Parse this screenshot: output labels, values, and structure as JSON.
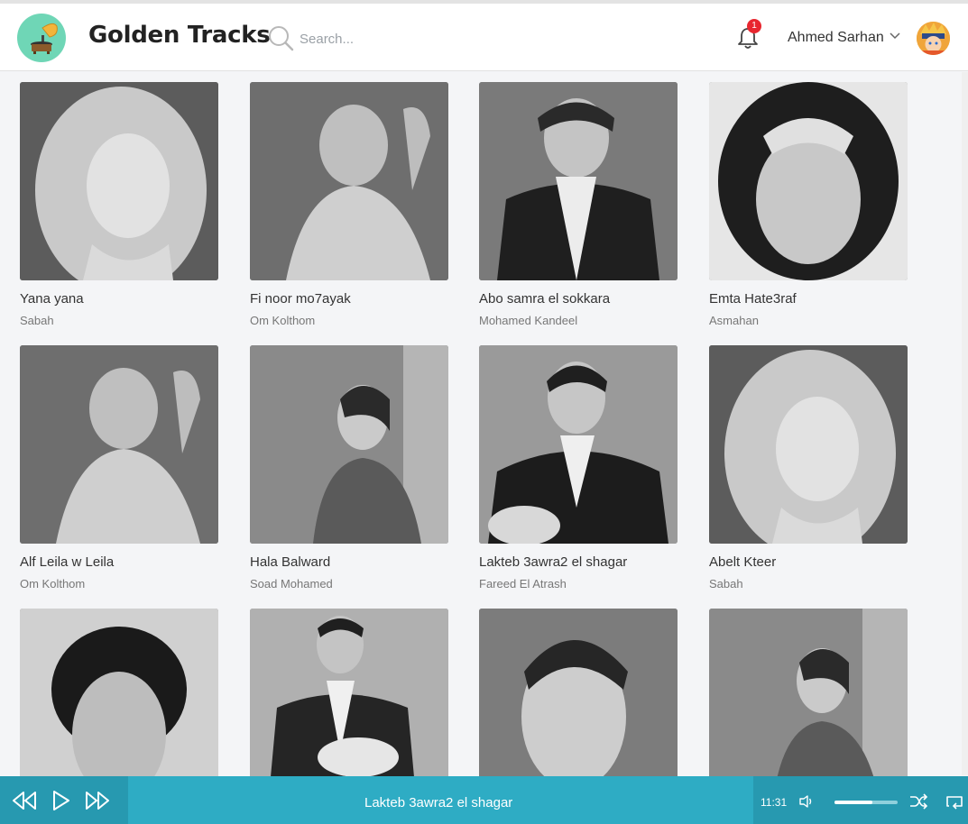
{
  "app": {
    "title": "Golden Tracks"
  },
  "header": {
    "search_placeholder": "Search...",
    "notifications_count": "1",
    "user_name": "Ahmed Sarhan"
  },
  "tracks": [
    {
      "title": "Yana yana",
      "artist": "Sabah"
    },
    {
      "title": "Fi noor mo7ayak",
      "artist": "Om Kolthom"
    },
    {
      "title": "Abo samra el sokkara",
      "artist": "Mohamed Kandeel"
    },
    {
      "title": "Emta Hate3raf",
      "artist": "Asmahan"
    },
    {
      "title": "Alf Leila w Leila",
      "artist": "Om Kolthom"
    },
    {
      "title": "Hala Balward",
      "artist": "Soad Mohamed"
    },
    {
      "title": "Lakteb 3awra2 el shagar",
      "artist": "Fareed El Atrash"
    },
    {
      "title": "Abelt Kteer",
      "artist": "Sabah"
    },
    {
      "title": "",
      "artist": ""
    },
    {
      "title": "",
      "artist": ""
    },
    {
      "title": "",
      "artist": ""
    },
    {
      "title": "",
      "artist": ""
    }
  ],
  "player": {
    "now_playing": "Lakteb 3awra2 el shagar",
    "time": "11:31",
    "volume": 0.6
  },
  "colors": {
    "player_bar": "#2eacc4",
    "player_dark": "#2799b0",
    "logo_bg": "#6fd6b6",
    "badge": "#e8262f"
  },
  "icons": {
    "logo": "gramophone-icon",
    "search": "search-icon",
    "notifications": "bell-icon",
    "user_menu": "chevron-down-icon",
    "prev": "rewind-icon",
    "play": "play-icon",
    "next": "fast-forward-icon",
    "volume": "volume-icon",
    "shuffle": "shuffle-icon",
    "repeat": "repeat-icon"
  }
}
